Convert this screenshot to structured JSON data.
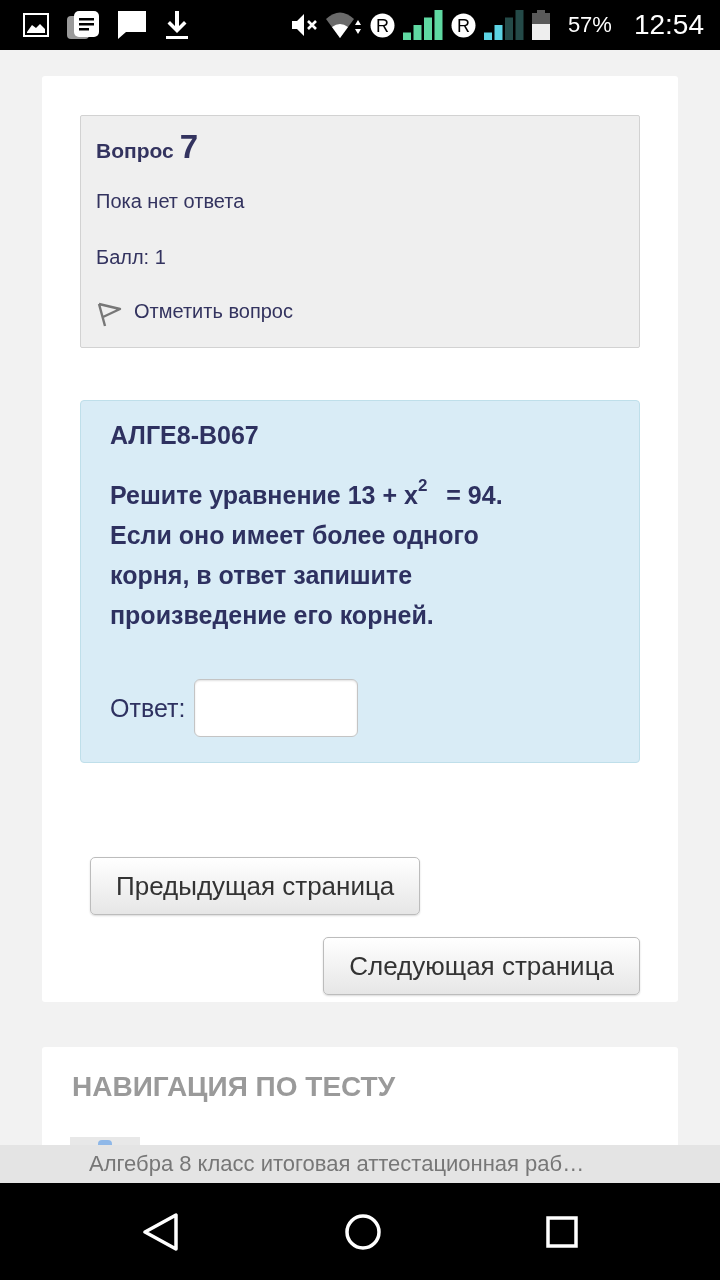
{
  "status_bar": {
    "sim_slots": [
      {
        "roaming_label": "R"
      },
      {
        "roaming_label": "R"
      }
    ],
    "battery_percent": "57%",
    "time": "12:54"
  },
  "question_info": {
    "label": "Вопрос",
    "number": "7",
    "state": "Пока нет ответа",
    "grade": "Балл: 1",
    "flag_label": "Отметить вопрос",
    "flagged": false
  },
  "question": {
    "code": "АЛГЕ8-В067",
    "text": "Решите уравнение 13 + x$^{2}$ = 94. Если оно имеет более одного корня, в ответ запишите произведение его корней.",
    "answer_label": "Ответ:"
  },
  "buttons": [
    {
      "kind": "previous",
      "label": "Предыдущая страница"
    },
    {
      "kind": "next",
      "label": "Следующая страница"
    }
  ],
  "navigation": {
    "title": "НАВИГАЦИЯ ПО ТЕСТУ"
  },
  "page_title": "Алгебра 8 класс итоговая аттестационная раб…"
}
